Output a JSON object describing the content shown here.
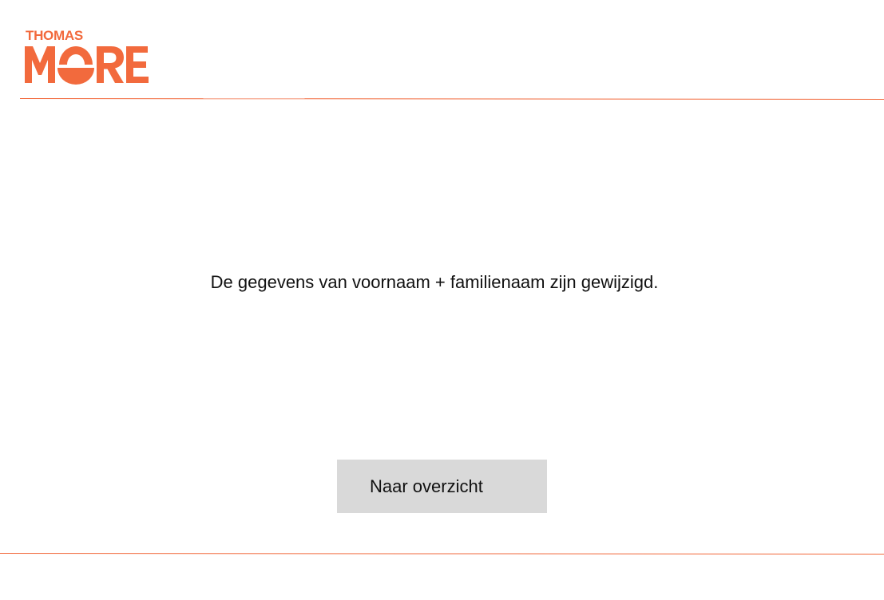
{
  "brand": {
    "logo_top_line": "THOMAS",
    "logo_bottom_line": "MORE",
    "color": "#f26a3d"
  },
  "content": {
    "message": "De gegevens van voornaam + familienaam zijn gewijzigd."
  },
  "actions": {
    "overview_button_label": "Naar overzicht",
    "button_color": "#d9d9d9"
  }
}
